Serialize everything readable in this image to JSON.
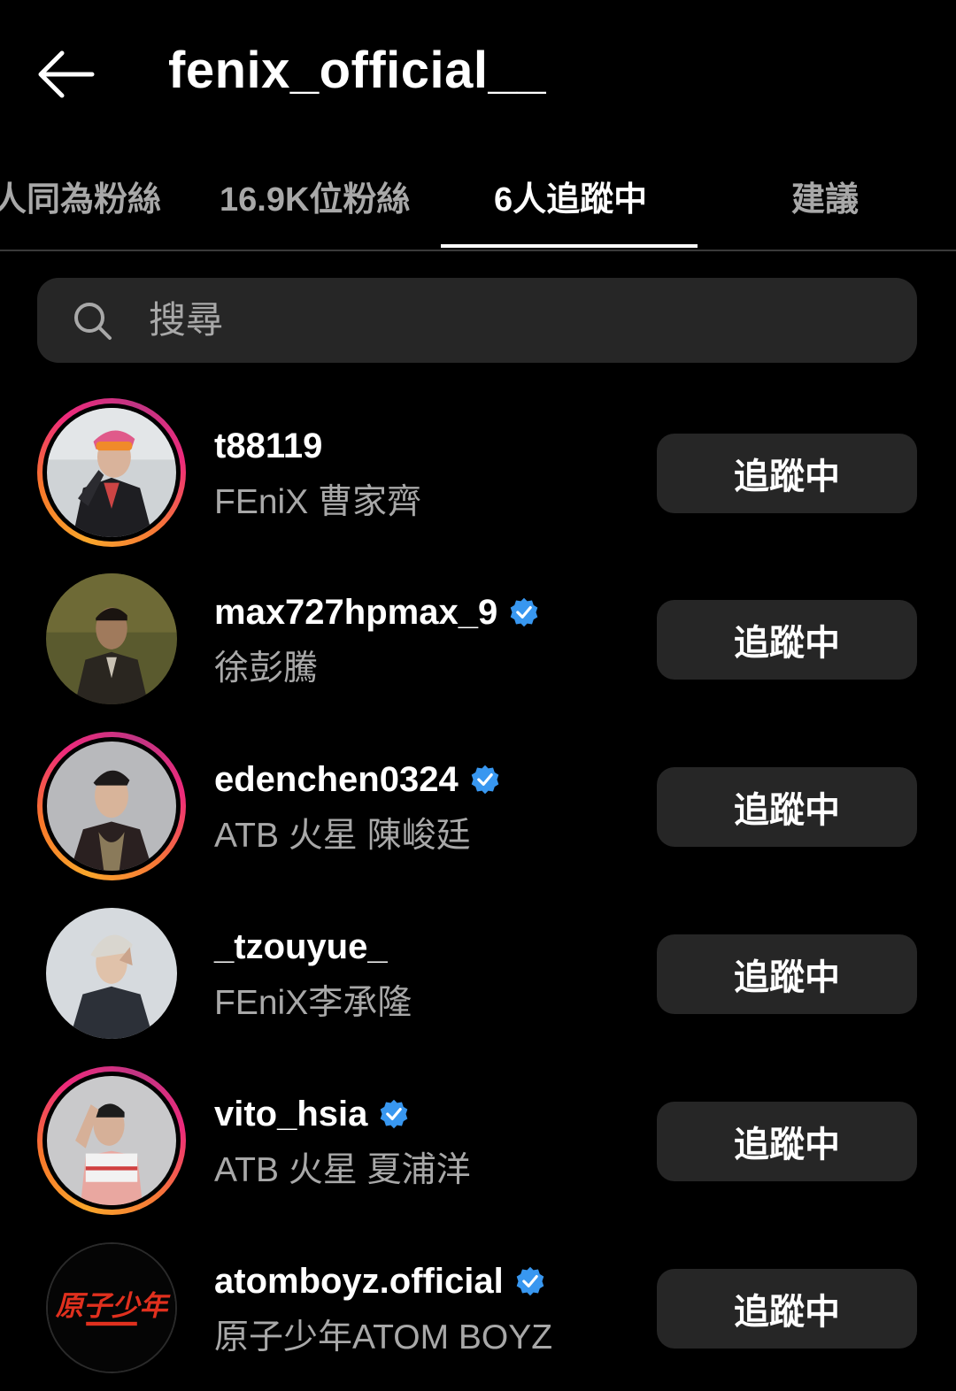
{
  "header": {
    "back_icon": "arrow-left-icon",
    "title": "fenix_official__"
  },
  "tabs": [
    {
      "label": "人同為粉絲",
      "active": false
    },
    {
      "label": "16.9K位粉絲",
      "active": false
    },
    {
      "label": "6人追蹤中",
      "active": true
    },
    {
      "label": "建議",
      "active": false
    }
  ],
  "search": {
    "icon": "search-icon",
    "placeholder": "搜尋",
    "value": ""
  },
  "accounts": [
    {
      "username": "t88119",
      "full_name": "FEniX 曹家齊",
      "verified": false,
      "story_ring": true,
      "button_label": "追蹤中"
    },
    {
      "username": "max727hpmax_9",
      "full_name": "徐彭騰",
      "verified": true,
      "story_ring": false,
      "button_label": "追蹤中"
    },
    {
      "username": "edenchen0324",
      "full_name": "ATB 火星 陳峻廷",
      "verified": true,
      "story_ring": true,
      "button_label": "追蹤中"
    },
    {
      "username": "_tzouyue_",
      "full_name": "FEniX李承隆",
      "verified": false,
      "story_ring": false,
      "button_label": "追蹤中"
    },
    {
      "username": "vito_hsia",
      "full_name": "ATB 火星 夏浦洋",
      "verified": true,
      "story_ring": true,
      "button_label": "追蹤中"
    },
    {
      "username": "atomboyz.official",
      "full_name": "原子少年ATOM BOYZ",
      "verified": true,
      "story_ring": false,
      "button_label": "追蹤中",
      "avatar_logo_text": "原子少年"
    }
  ],
  "colors": {
    "background": "#000000",
    "surface": "#262626",
    "text_secondary": "#a8a8a8",
    "verified_blue": "#3897f0"
  }
}
